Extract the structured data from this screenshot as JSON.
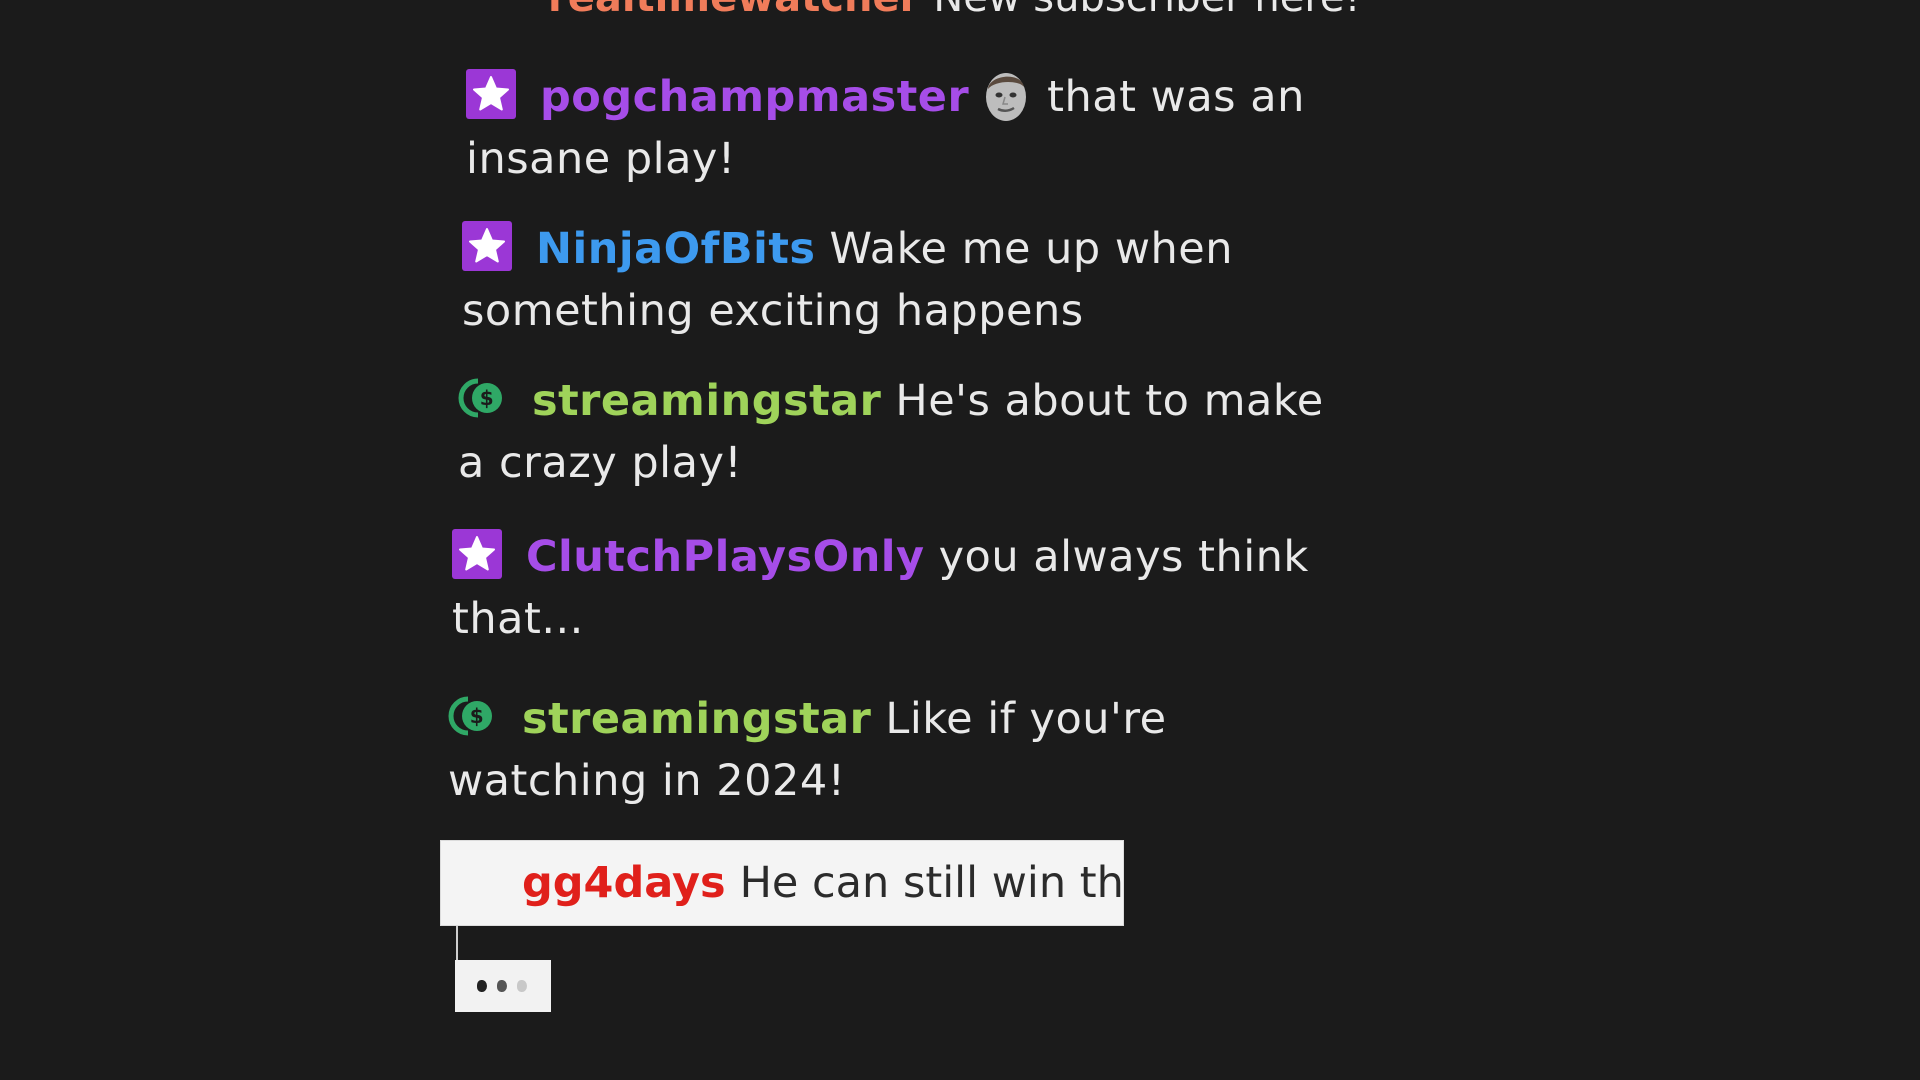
{
  "chat": {
    "top_partial": {
      "username": "realtimewatcher",
      "username_color": "#f07c5a",
      "text": "New subscriber here!"
    },
    "messages": [
      {
        "badge": "star-badge-icon",
        "username": "pogchampmaster",
        "username_color": "#a64de8",
        "emote": "kappa-face-emote-icon",
        "text": "that was an insane play!"
      },
      {
        "badge": "star-badge-icon",
        "username": "NinjaOfBits",
        "username_color": "#3d9aef",
        "text": "Wake me up when something exciting happens"
      },
      {
        "badge": "coin-badge-icon",
        "username": "streamingstar",
        "username_color": "#9fd35a",
        "text": "He's about to make a crazy play!"
      },
      {
        "badge": "star-badge-icon",
        "username": "ClutchPlaysOnly",
        "username_color": "#a64de8",
        "text": "you always think that..."
      },
      {
        "badge": "coin-badge-icon",
        "username": "streamingstar",
        "username_color": "#9fd35a",
        "text": "Like if you're watching in 2024!"
      }
    ],
    "incoming": {
      "username": "gg4days",
      "username_color": "#e0201b",
      "text": "He can still win this"
    },
    "typing_indicator": {
      "icon": "typing-dots-icon"
    }
  },
  "colors": {
    "background": "#1b1b1b",
    "message_text": "#e9e9e9",
    "star_badge": "#9b37d6",
    "coin_badge": "#2fa866"
  }
}
